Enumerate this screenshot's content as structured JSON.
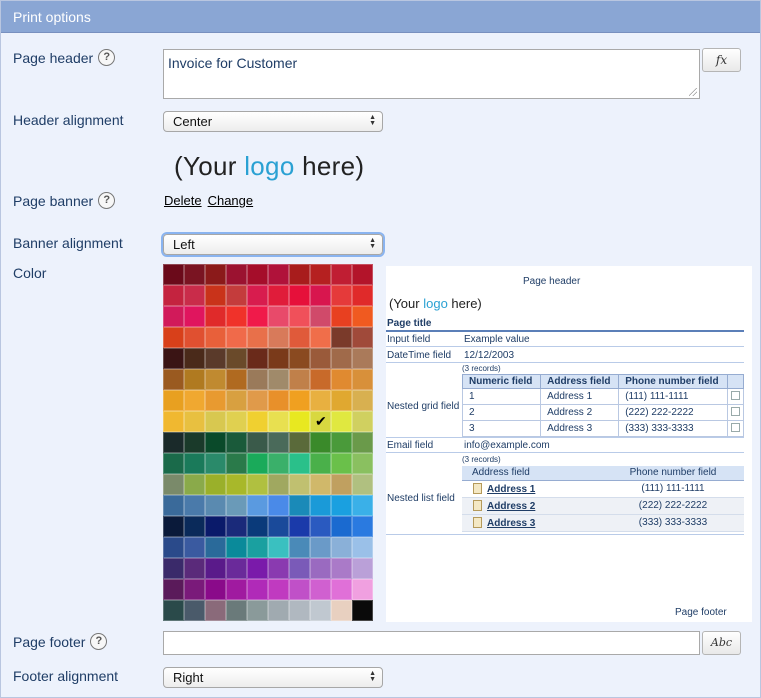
{
  "panel": {
    "title": "Print options"
  },
  "page_header": {
    "label": "Page header",
    "value": "Invoice for Customer",
    "fx_button": "fx"
  },
  "header_alignment": {
    "label": "Header alignment",
    "selected": "Center"
  },
  "page_banner": {
    "label": "Page banner",
    "logo_left": "(Your ",
    "logo_word": "logo",
    "logo_right": " here)",
    "delete_link": "Delete",
    "change_link": "Change"
  },
  "banner_alignment": {
    "label": "Banner alignment",
    "selected": "Left"
  },
  "color": {
    "label": "Color",
    "selected_index": 77,
    "swatches": [
      "#6b0a1a",
      "#7a1422",
      "#8b1a1a",
      "#9b1230",
      "#a50d2a",
      "#b0123a",
      "#a81c1c",
      "#b52020",
      "#c01e33",
      "#b3142a",
      "#c4233f",
      "#c92c4a",
      "#c9331a",
      "#c43c3c",
      "#d81c4e",
      "#e01c3a",
      "#e6103a",
      "#d8164e",
      "#e53a3a",
      "#e02a2a",
      "#d11a5a",
      "#e0155e",
      "#e02a2a",
      "#f0322a",
      "#f01a4a",
      "#e84a6a",
      "#f0505a",
      "#d04a6a",
      "#e84020",
      "#f05a20",
      "#d8401a",
      "#e05030",
      "#e8603a",
      "#f06a4a",
      "#e8704a",
      "#d87a5a",
      "#e05a3a",
      "#f06e4a",
      "#7a3a2a",
      "#a04a3a",
      "#3a1414",
      "#4a2a1a",
      "#5a3a2a",
      "#6a4a2a",
      "#6a2a1a",
      "#7a3a1a",
      "#8a4a20",
      "#9a5a3a",
      "#a06a4a",
      "#aa7a5a",
      "#9a5a20",
      "#b07a20",
      "#c08a30",
      "#b06a20",
      "#9a7a5a",
      "#a08a6a",
      "#c0804a",
      "#c86a2a",
      "#e08a30",
      "#d8903a",
      "#e8a020",
      "#f0a830",
      "#e89a30",
      "#d8a040",
      "#e09a4a",
      "#e8902a",
      "#f0a020",
      "#e8b040",
      "#e0a830",
      "#d8b050",
      "#f0b830",
      "#e8c040",
      "#d8c850",
      "#e0d050",
      "#f0d030",
      "#e8e050",
      "#e8e820",
      "#d8d840",
      "#e0e840",
      "#d0d060",
      "#1a2a2a",
      "#1a3a2a",
      "#0a4a2a",
      "#1a5a3a",
      "#3a5a4a",
      "#4a6a5a",
      "#5a6a3a",
      "#3a8a2a",
      "#4a9a3a",
      "#6a9a4a",
      "#1a6a4a",
      "#1a7a5a",
      "#2a8a6a",
      "#2a7a4a",
      "#1aaa5a",
      "#3ab06a",
      "#2ac08a",
      "#4ab04a",
      "#6ac04a",
      "#8ac060",
      "#7a8a6a",
      "#8aaa4a",
      "#9ab02a",
      "#a8b82a",
      "#b0c040",
      "#a0a860",
      "#c0c070",
      "#d0b86a",
      "#c0a060",
      "#b0c080",
      "#3a6a9a",
      "#4a7aaa",
      "#5a8ab0",
      "#6a9ab8",
      "#5a9ae0",
      "#4a8ae8",
      "#1a8ab8",
      "#1a9ad8",
      "#1aa0e0",
      "#3ab0e8",
      "#0a1a3a",
      "#0a2a5a",
      "#0a1a6a",
      "#1a2a7a",
      "#0a3a7a",
      "#1a4a9a",
      "#1a3aaa",
      "#2a5ac0",
      "#1a6ad0",
      "#2a7ae0",
      "#2a4a8a",
      "#3a5aa0",
      "#2a6a9a",
      "#0a8a9a",
      "#1aa0a0",
      "#3ac0c0",
      "#4a8ab8",
      "#6a9ac8",
      "#8ab0d8",
      "#9ac0e8",
      "#3a2a6a",
      "#5a2a7a",
      "#5a1a8a",
      "#6a2a9a",
      "#7a1aaa",
      "#8a3ab0",
      "#7a5ab8",
      "#9a6ac0",
      "#aa7ac8",
      "#baa0d8",
      "#5a1a5a",
      "#7a1a7a",
      "#8a0a8a",
      "#a01aa0",
      "#b02ab8",
      "#c03ac0",
      "#c050c8",
      "#d060d0",
      "#e070d8",
      "#f0a0e0",
      "#2a4a4a",
      "#4a5a6a",
      "#8a6a7a",
      "#6a7a7a",
      "#8a9a9a",
      "#a0aab0",
      "#b0b8c0",
      "#c0c8d0",
      "#e8d0c0",
      "#0a0a0a"
    ]
  },
  "preview": {
    "page_header": "Page header",
    "logo_left": "(Your ",
    "logo_word": "logo",
    "logo_right": " here)",
    "page_title": "Page title",
    "input_field_label": "Input field",
    "input_field_value": "Example value",
    "datetime_label": "DateTime field",
    "datetime_value": "12/12/2003",
    "grid_records": "(3 records)",
    "nested_grid_label": "Nested grid field",
    "grid_headers": [
      "Numeric field",
      "Address field",
      "Phone number field"
    ],
    "grid_rows": [
      [
        "1",
        "Address 1",
        "(111) 111-1111"
      ],
      [
        "2",
        "Address 2",
        "(222) 222-2222"
      ],
      [
        "3",
        "Address 3",
        "(333) 333-3333"
      ]
    ],
    "email_label": "Email field",
    "email_value": "info@example.com",
    "list_records": "(3 records)",
    "nested_list_label": "Nested list field",
    "list_headers": [
      "Address field",
      "Phone number field"
    ],
    "list_rows": [
      [
        "Address 1",
        "(111) 111-1111"
      ],
      [
        "Address 2",
        "(222) 222-2222"
      ],
      [
        "Address 3",
        "(333) 333-3333"
      ]
    ],
    "page_footer": "Page footer"
  },
  "page_footer": {
    "label": "Page footer",
    "value": "",
    "abc_button": "Abc"
  },
  "footer_alignment": {
    "label": "Footer alignment",
    "selected": "Right"
  }
}
